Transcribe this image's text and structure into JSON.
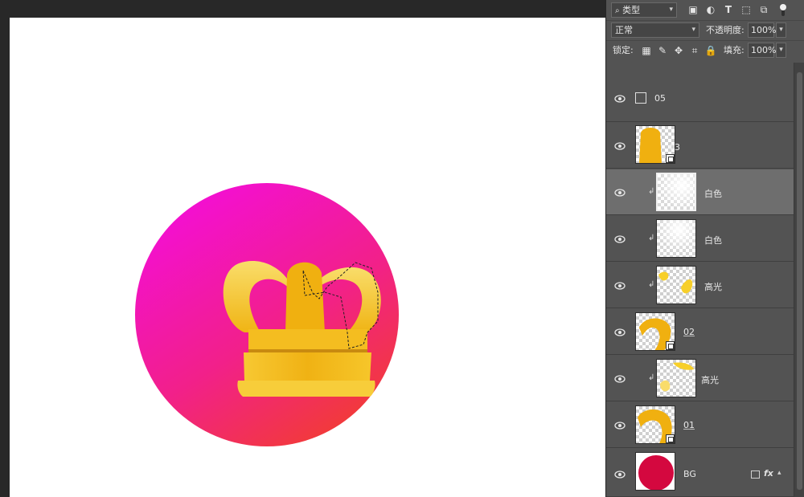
{
  "toolbar": {
    "filter_kind": "类型",
    "blend_mode": "正常",
    "opacity_label": "不透明度:",
    "opacity_value": "100%",
    "lock_label": "锁定:",
    "fill_label": "填充:",
    "fill_value": "100%",
    "filter_icons": [
      "image-filter-icon",
      "adjustment-filter-icon",
      "type-filter-icon",
      "shape-filter-icon",
      "smart-object-filter-icon",
      "filter-toggle-icon"
    ],
    "lock_icons": [
      "lock-transparent-icon",
      "lock-image-icon",
      "lock-position-icon",
      "lock-artboard-icon",
      "lock-all-icon"
    ]
  },
  "colors": {
    "crown_gold": "#f2b81c",
    "circle_top": "#f312c9",
    "circle_bottom": "#f23047",
    "bg_red": "#d4083f",
    "panel_bg": "#535353",
    "selected_row": "#6e6e6e"
  },
  "layers": [
    {
      "name": "05",
      "type": "artboard-group",
      "selected": false,
      "clipped": false
    },
    {
      "name": "03",
      "type": "smart-object",
      "selected": false,
      "clipped": false
    },
    {
      "name": "白色",
      "type": "pixel",
      "selected": true,
      "clipped": true
    },
    {
      "name": "白色",
      "type": "pixel",
      "selected": false,
      "clipped": true
    },
    {
      "name": "高光",
      "type": "pixel",
      "selected": false,
      "clipped": true
    },
    {
      "name": "02",
      "type": "smart-object",
      "selected": false,
      "clipped": false
    },
    {
      "name": "高光",
      "type": "pixel",
      "selected": false,
      "clipped": true
    },
    {
      "name": "01",
      "type": "smart-object",
      "selected": false,
      "clipped": false
    },
    {
      "name": "BG",
      "type": "shape",
      "selected": false,
      "clipped": false,
      "fx": "fx"
    }
  ]
}
